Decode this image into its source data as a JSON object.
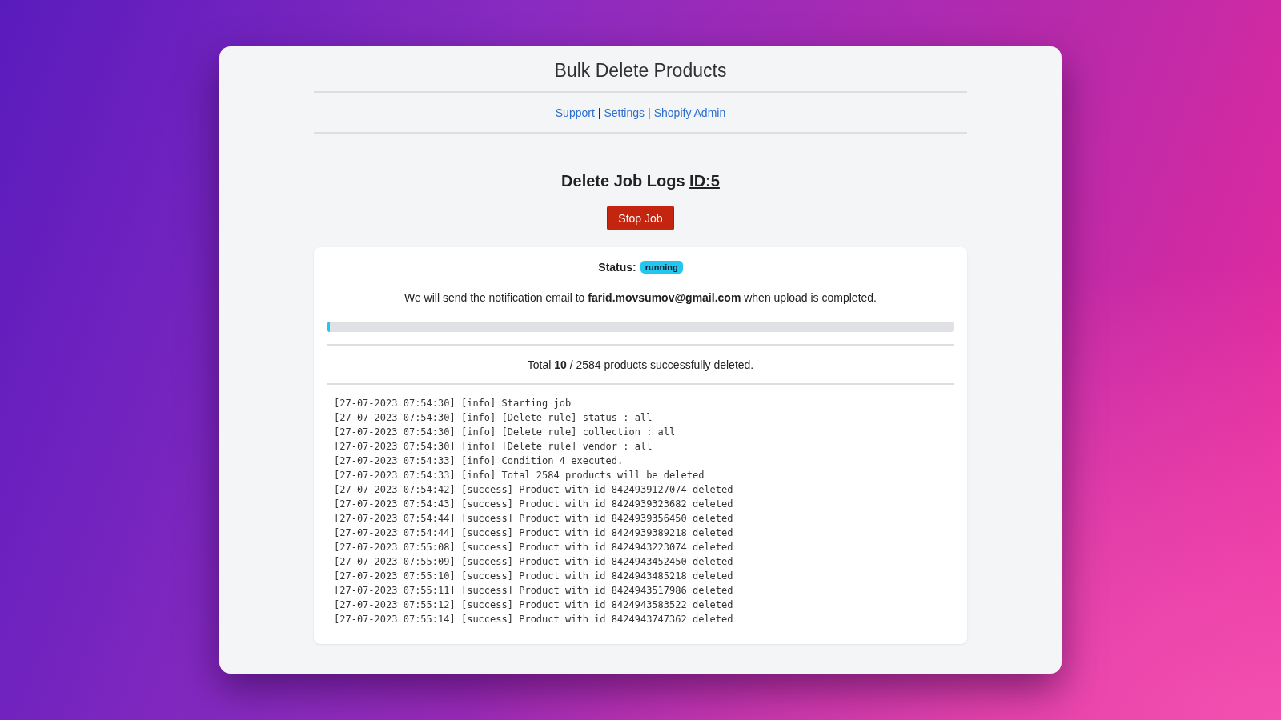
{
  "app_title": "Bulk Delete Products",
  "nav": {
    "links": [
      "Support",
      "Settings",
      "Shopify Admin"
    ],
    "separator": "|"
  },
  "job": {
    "heading": "Delete Job Logs",
    "id_link": "ID:5",
    "stop_button": "Stop Job"
  },
  "status": {
    "label": "Status:",
    "badge": "running",
    "color": "#22c7f0"
  },
  "notification": "We will send the notification email to **farid.movsumov@gmail.com** when upload is completed.",
  "progress": {
    "level": 0.004
  },
  "summary": "Total **10** / 2584 products successfully deleted.",
  "logs": [
    "[27-07-2023 07:54:30] [info] Starting job",
    "[27-07-2023 07:54:30] [info] [Delete rule] status : all",
    "[27-07-2023 07:54:30] [info] [Delete rule] collection : all",
    "[27-07-2023 07:54:30] [info] [Delete rule] vendor : all",
    "[27-07-2023 07:54:33] [info] Condition 4 executed.",
    "[27-07-2023 07:54:33] [info] Total 2584 products will be deleted",
    "[27-07-2023 07:54:42] [success] Product with id 8424939127074 deleted",
    "[27-07-2023 07:54:43] [success] Product with id 8424939323682 deleted",
    "[27-07-2023 07:54:44] [success] Product with id 8424939356450 deleted",
    "[27-07-2023 07:54:44] [success] Product with id 8424939389218 deleted",
    "[27-07-2023 07:55:08] [success] Product with id 8424943223074 deleted",
    "[27-07-2023 07:55:09] [success] Product with id 8424943452450 deleted",
    "[27-07-2023 07:55:10] [success] Product with id 8424943485218 deleted",
    "[27-07-2023 07:55:11] [success] Product with id 8424943517986 deleted",
    "[27-07-2023 07:55:12] [success] Product with id 8424943583522 deleted",
    "[27-07-2023 07:55:14] [success] Product with id 8424943747362 deleted"
  ]
}
